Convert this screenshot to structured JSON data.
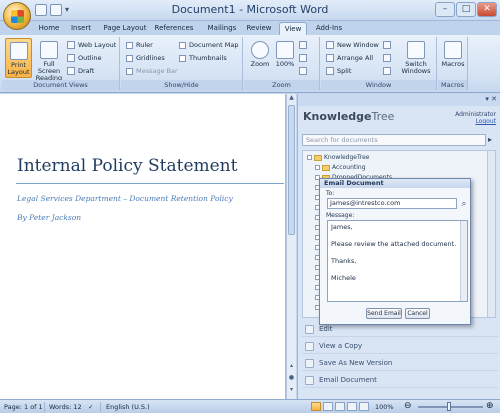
{
  "window": {
    "title": "Document1 - Microsoft Word",
    "controls": [
      "–",
      "□",
      "✕"
    ]
  },
  "tabs": [
    "Home",
    "Insert",
    "Page Layout",
    "References",
    "Mailings",
    "Review",
    "View",
    "Add-Ins"
  ],
  "active_tab": "View",
  "ribbon": {
    "document_views": {
      "label": "Document Views",
      "print_layout": "Print Layout",
      "full_screen": "Full Screen Reading",
      "web_layout": "Web Layout",
      "outline": "Outline",
      "draft": "Draft"
    },
    "show_hide": {
      "label": "Show/Hide",
      "ruler": "Ruler",
      "gridlines": "Gridlines",
      "message_bar": "Message Bar",
      "document_map": "Document Map",
      "thumbnails": "Thumbnails"
    },
    "zoom": {
      "label": "Zoom",
      "zoom": "Zoom",
      "percent": "100%"
    },
    "window": {
      "label": "Window",
      "new_window": "New Window",
      "arrange_all": "Arrange All",
      "split": "Split",
      "switch_windows": "Switch Windows"
    },
    "macros": {
      "label": "Macros",
      "macros": "Macros"
    }
  },
  "document": {
    "title": "Internal Policy Statement",
    "subtitle": "Legal Services Department – Document Retention Policy",
    "author": "By Peter Jackson"
  },
  "pane": {
    "logo_main": "Knowledge",
    "logo_tree": "Tree",
    "user": "Administrator",
    "logout": "Logout",
    "search_placeholder": "Search for documents",
    "tree": {
      "root": "KnowledgeTree",
      "items": [
        "Accounting",
        "DroppedDocuments"
      ]
    },
    "actions": [
      "Edit",
      "View a Copy",
      "Save As New Version",
      "Email Document"
    ]
  },
  "email_dialog": {
    "title": "Email Document",
    "to_label": "To:",
    "to_value": "James@intrestco.com",
    "message_label": "Message:",
    "message_lines": [
      "James,",
      "Please review the attached document.",
      "Thanks,",
      "Michele"
    ],
    "send_label": "Send Email",
    "cancel_label": "Cancel"
  },
  "statusbar": {
    "page": "Page: 1 of 1",
    "words": "Words: 12",
    "language": "English (U.S.)",
    "zoom": "100%"
  }
}
